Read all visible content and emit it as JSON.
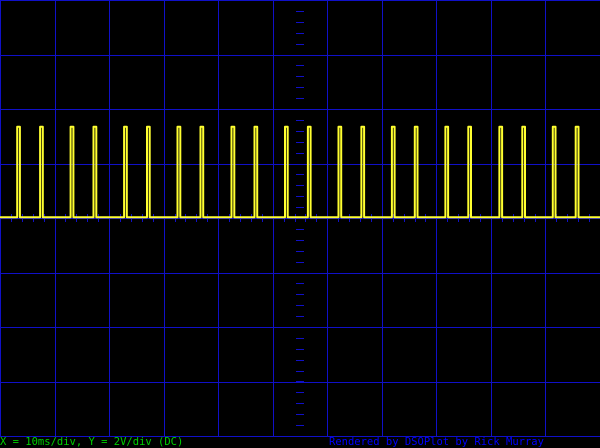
{
  "chart_data": {
    "type": "line",
    "title": "",
    "xlabel": "",
    "ylabel": "",
    "x_unit": "ms",
    "y_unit": "V",
    "x_per_div": 10,
    "y_per_div": 2,
    "coupling": "DC",
    "xlim": [
      -55,
      55
    ],
    "ylim": [
      -8,
      8
    ],
    "grid": true,
    "colors": {
      "background": "#000000",
      "grid": "#1010c8",
      "trace": "#ffff30"
    },
    "pulse_high_v": 3.35,
    "baseline_v": 0.03,
    "pulse_width_ms": 0.5,
    "pulse_starts_ms": [
      -51.85,
      -47.65,
      -42.05,
      -37.85,
      -32.25,
      -28.05,
      -22.45,
      -18.25,
      -12.55,
      -8.35,
      -2.75,
      1.45,
      7.05,
      11.25,
      16.85,
      21.05,
      26.65,
      30.85,
      36.55,
      40.75,
      46.35,
      50.55
    ]
  },
  "footer": {
    "scale_readout": "X = 10ms/div, Y = 2V/div (DC)",
    "credit": "Rendered by DSOPlot by Rick Murray"
  }
}
